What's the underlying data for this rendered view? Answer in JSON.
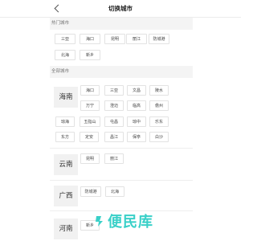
{
  "header": {
    "title": "切换城市",
    "back_icon": "chevron-left-icon"
  },
  "hot": {
    "label": "热门城市",
    "cities": [
      "三亚",
      "海口",
      "昆明",
      "丽江",
      "防城港",
      "北海",
      "新乡"
    ]
  },
  "all": {
    "label": "全部城市"
  },
  "provinces": [
    {
      "name": "海南",
      "cities": [
        "海口",
        "三亚",
        "文昌",
        "陵水",
        "万宁",
        "澄迈",
        "临高",
        "儋州",
        "琼海",
        "五指山",
        "屯昌",
        "琼中",
        "乐东",
        "东方",
        "定安",
        "昌江",
        "保亭",
        "白沙"
      ]
    },
    {
      "name": "云南",
      "cities": [
        "昆明",
        "丽江"
      ]
    },
    {
      "name": "广西",
      "cities": [
        "防城港",
        "北海"
      ]
    },
    {
      "name": "河南",
      "cities": [
        "新乡"
      ]
    }
  ],
  "watermark": {
    "text": "便民库",
    "accent": "#39d0c8"
  }
}
